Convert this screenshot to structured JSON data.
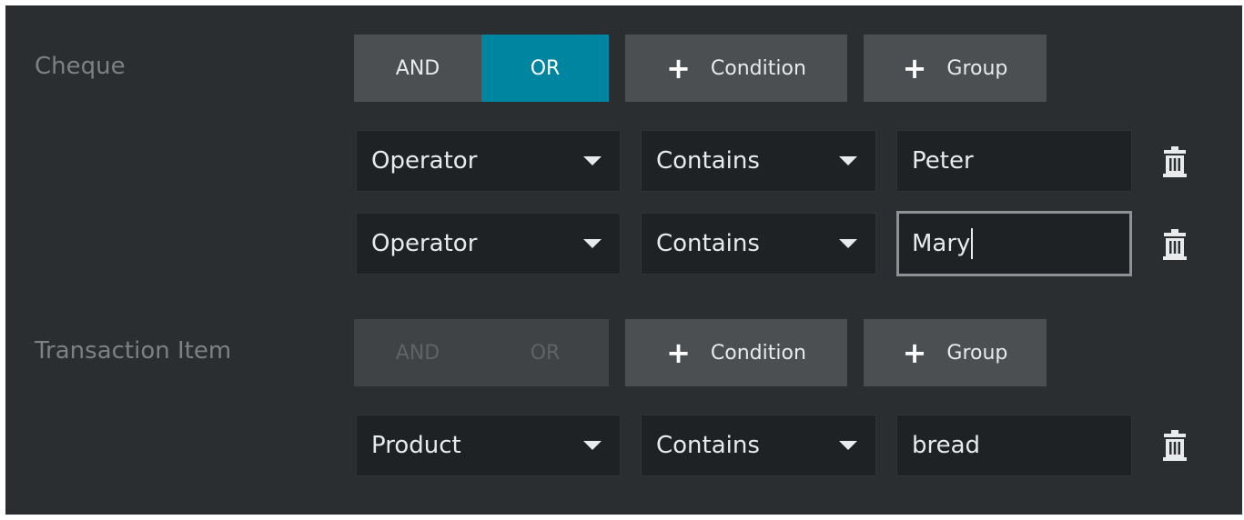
{
  "groups": [
    {
      "label": "Cheque",
      "logic": {
        "and_label": "AND",
        "or_label": "OR",
        "selected": "OR",
        "enabled": true
      },
      "add_condition_label": "Condition",
      "add_group_label": "Group",
      "conditions": [
        {
          "field": "Operator",
          "operator": "Contains",
          "value": "Peter",
          "focused": false
        },
        {
          "field": "Operator",
          "operator": "Contains",
          "value": "Mary",
          "focused": true
        }
      ]
    },
    {
      "label": "Transaction Item",
      "logic": {
        "and_label": "AND",
        "or_label": "OR",
        "selected": null,
        "enabled": false
      },
      "add_condition_label": "Condition",
      "add_group_label": "Group",
      "conditions": [
        {
          "field": "Product",
          "operator": "Contains",
          "value": "bread",
          "focused": false
        }
      ]
    }
  ],
  "icons": {
    "plus": "plus-icon",
    "caret": "chevron-down-icon",
    "delete": "trash-icon"
  },
  "colors": {
    "background": "#2b2e30",
    "accent": "#0085a1",
    "button": "#4b4f52",
    "input": "#1f2224"
  }
}
